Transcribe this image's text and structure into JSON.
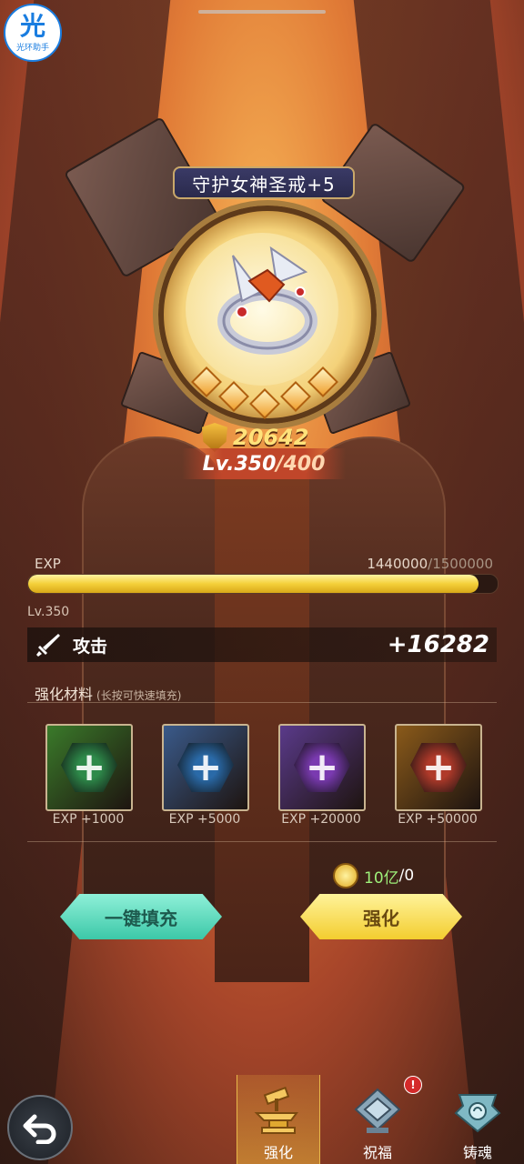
{
  "helper": {
    "glyph": "光",
    "name": "光环助手"
  },
  "item": {
    "name": "守护女神圣戒+5",
    "stars": 5,
    "power": "20642",
    "level_current": "Lv.350",
    "level_max": "/400"
  },
  "exp": {
    "label": "EXP",
    "current": "1440000",
    "max": "/1500000",
    "progress": 0.96,
    "level_caption": "Lv.350"
  },
  "attribute": {
    "icon": "sword-icon",
    "name": "攻击",
    "value": "+16282"
  },
  "materials": {
    "title": "强化材料",
    "hint": "(长按可快速填充)",
    "items": [
      {
        "label": "EXP +1000",
        "color": "#3a7a2a",
        "gem": "#2e8a4a"
      },
      {
        "label": "EXP +5000",
        "color": "#3a5a8a",
        "gem": "#2a6aa8"
      },
      {
        "label": "EXP +20000",
        "color": "#5a3a8a",
        "gem": "#7a3ab0"
      },
      {
        "label": "EXP +50000",
        "color": "#8a5a1a",
        "gem": "#b03a2a"
      }
    ]
  },
  "cost": {
    "have": "10亿",
    "need": "/0"
  },
  "buttons": {
    "auto_fill": "一键填充",
    "enhance": "强化"
  },
  "tabs": [
    {
      "label": "强化",
      "icon": "anvil-icon",
      "active": true
    },
    {
      "label": "祝福",
      "icon": "blessing-icon",
      "active": false
    },
    {
      "label": "铸魂",
      "icon": "soul-cast-icon",
      "active": false
    }
  ],
  "badge": "!"
}
